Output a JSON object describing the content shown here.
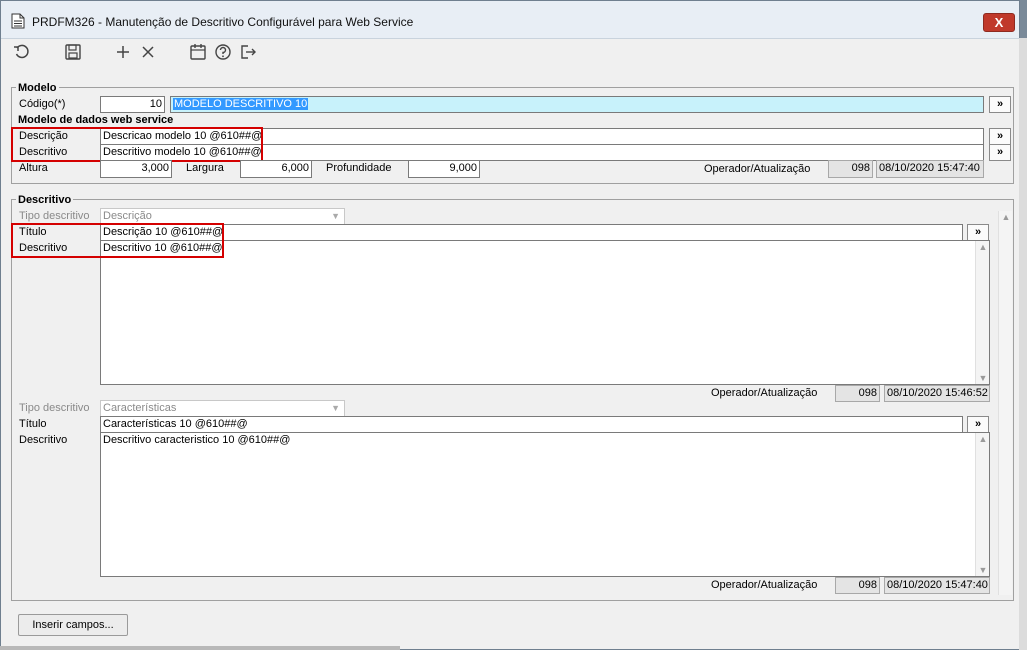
{
  "window": {
    "title": "PRDFM326 - Manutenção de Descritivo Configurável para Web Service",
    "close_label": "X"
  },
  "toolbar": {
    "icons": [
      "undo-icon",
      "save-icon",
      "add-icon",
      "delete-icon",
      "calendar-icon",
      "help-icon",
      "exit-icon"
    ]
  },
  "modelo": {
    "section_label": "Modelo",
    "codigo_label": "Código(*)",
    "codigo_value": "10",
    "nome_value": "MODELO DESCRITIVO 10",
    "more_label": "»"
  },
  "modelo_dados": {
    "section_label": "Modelo de dados web service",
    "descricao_label": "Descrição",
    "descricao_value": "Descricao modelo 10 @610##@",
    "descritivo_label": "Descritivo",
    "descritivo_value": "Descritivo modelo 10 @610##@",
    "altura_label": "Altura",
    "altura_value": "3,000",
    "largura_label": "Largura",
    "largura_value": "6,000",
    "profundidade_label": "Profundidade",
    "profundidade_value": "9,000",
    "operador_label": "Operador/Atualização",
    "operador_value": "098",
    "atualizacao_value": "08/10/2020 15:47:40",
    "more_label": "»"
  },
  "descritivo": {
    "section_label": "Descritivo",
    "blocks": [
      {
        "tipo_label": "Tipo descritivo",
        "tipo_value": "Descrição",
        "titulo_label": "Título",
        "titulo_value": "Descrição 10 @610##@",
        "descritivo_label": "Descritivo",
        "descritivo_value": "Descritivo 10 @610##@",
        "operador_label": "Operador/Atualização",
        "operador_value": "098",
        "atualizacao_value": "08/10/2020 15:46:52",
        "more_label": "»"
      },
      {
        "tipo_label": "Tipo descritivo",
        "tipo_value": "Características",
        "titulo_label": "Título",
        "titulo_value": "Características 10 @610##@",
        "descritivo_label": "Descritivo",
        "descritivo_value": "Descritivo caracteristico 10 @610##@",
        "operador_label": "Operador/Atualização",
        "operador_value": "098",
        "atualizacao_value": "08/10/2020 15:47:40",
        "more_label": "»"
      }
    ]
  },
  "footer": {
    "inserir_label": "Inserir campos..."
  },
  "colors": {
    "highlight_box": "#d40000",
    "selection": "#3399ff",
    "selected_field_bg": "#c8f2fb"
  }
}
